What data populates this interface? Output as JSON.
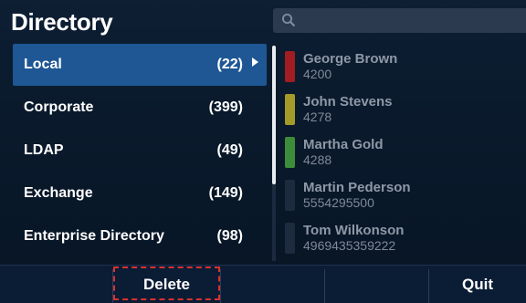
{
  "header": {
    "title": "Directory"
  },
  "search": {
    "icon": "search-icon",
    "value": ""
  },
  "directories": [
    {
      "label": "Local",
      "count": "(22)",
      "selected": true
    },
    {
      "label": "Corporate",
      "count": "(399)",
      "selected": false
    },
    {
      "label": "LDAP",
      "count": "(49)",
      "selected": false
    },
    {
      "label": "Exchange",
      "count": "(149)",
      "selected": false
    },
    {
      "label": "Enterprise Directory",
      "count": "(98)",
      "selected": false
    }
  ],
  "contacts": [
    {
      "name": "George Brown",
      "number": "4200",
      "status_color": "#a11d22"
    },
    {
      "name": "John Stevens",
      "number": "4278",
      "status_color": "#a39a2a"
    },
    {
      "name": "Martha Gold",
      "number": "4288",
      "status_color": "#3d8c3a"
    },
    {
      "name": "Martin Pederson",
      "number": "5554295500",
      "status_color": "#1c2b3d"
    },
    {
      "name": "Tom Wilkonson",
      "number": "4969435359222",
      "status_color": "#1c2b3d"
    }
  ],
  "softkeys": {
    "delete": "Delete",
    "quit": "Quit"
  },
  "colors": {
    "selection": "#1e5794",
    "focus_outline": "#d8312f",
    "background": "#0e1e33"
  }
}
